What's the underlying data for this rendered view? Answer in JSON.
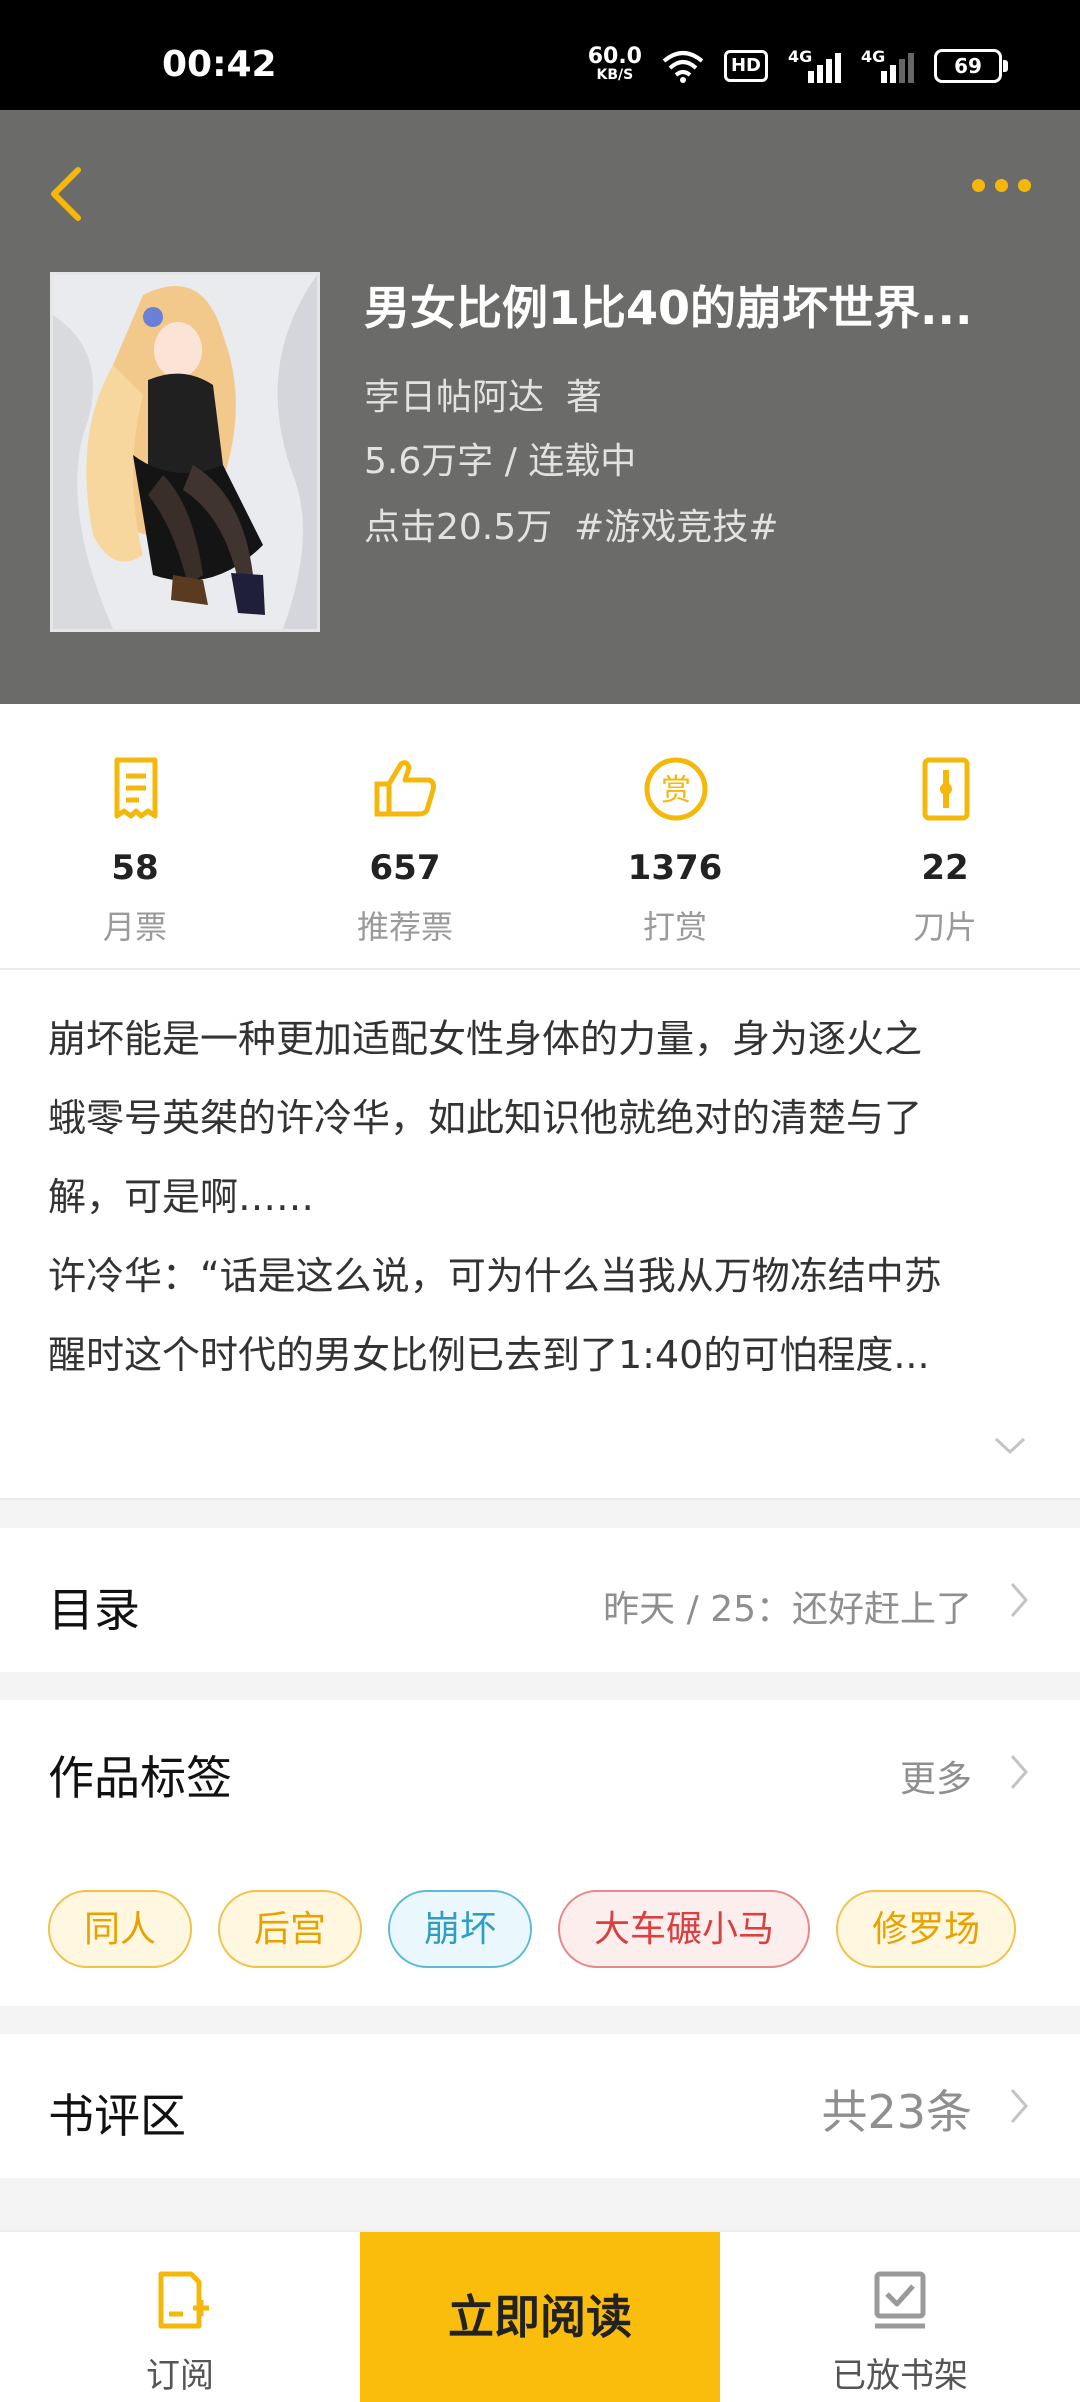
{
  "status_bar": {
    "time": "00:42",
    "net_speed_value": "60.0",
    "net_speed_unit": "KB/S",
    "hd_label": "HD",
    "signal1_label": "4G",
    "signal2_label": "4G",
    "battery": "69"
  },
  "header": {
    "back_icon": "chevron-left-icon",
    "more_icon": "more-dots-icon",
    "title": "男女比例1比40的崩坏世界...",
    "author": "孛日帖阿达",
    "author_suffix": "著",
    "words": "5.6万字 / 连载中",
    "clicks": "点击20.5万",
    "genre": "#游戏竞技#",
    "accent_color": "#f5b80a",
    "bg_color": "#6b6c69"
  },
  "stats": [
    {
      "icon": "monthly-ticket-icon",
      "value": "58",
      "label": "月票"
    },
    {
      "icon": "thumbs-up-icon",
      "value": "657",
      "label": "推荐票"
    },
    {
      "icon": "reward-coin-icon",
      "value": "1376",
      "label": "打赏"
    },
    {
      "icon": "blade-card-icon",
      "value": "22",
      "label": "刀片"
    }
  ],
  "synopsis": {
    "lines": [
      "崩坏能是一种更加适配女性身体的力量，身为逐火之",
      "蛾零号英桀的许冷华，如此知识他就绝对的清楚与了",
      "解，可是啊……",
      "许冷华：“话是这么说，可为什么当我从万物冻结中苏",
      "醒时这个时代的男女比例已去到了1:40的可怕程度..."
    ]
  },
  "catalog": {
    "title": "目录",
    "latest": "昨天 / 25：还好赶上了"
  },
  "tags_section": {
    "title": "作品标签",
    "more": "更多",
    "tags": [
      {
        "label": "同人",
        "color": "#e8a200",
        "bg": "#fff7e0",
        "border": "#f0c24a"
      },
      {
        "label": "后宫",
        "color": "#e8a200",
        "bg": "#fff7e0",
        "border": "#f0c24a"
      },
      {
        "label": "崩坏",
        "color": "#2f9ec4",
        "bg": "#eaf7fc",
        "border": "#5fb9d8"
      },
      {
        "label": "大车碾小马",
        "color": "#d94040",
        "bg": "#fdeeee",
        "border": "#e88787"
      },
      {
        "label": "修罗场",
        "color": "#e8a200",
        "bg": "#fff7e0",
        "border": "#f0c24a"
      }
    ]
  },
  "reviews": {
    "title": "书评区",
    "count": "共23条"
  },
  "bottom_bar": {
    "subscribe": "订阅",
    "read_now": "立即阅读",
    "bookshelf": "已放书架"
  }
}
